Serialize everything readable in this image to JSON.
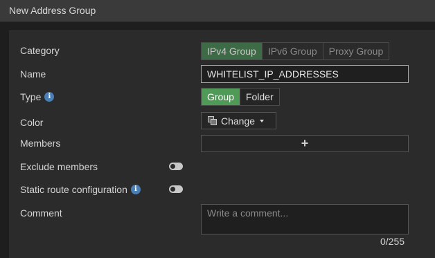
{
  "window": {
    "title": "New Address Group"
  },
  "form": {
    "category": {
      "label": "Category",
      "options": [
        "IPv4 Group",
        "IPv6 Group",
        "Proxy Group"
      ],
      "selected": "IPv4 Group"
    },
    "name": {
      "label": "Name",
      "value": "WHITELIST_IP_ADDRESSES"
    },
    "type": {
      "label": "Type",
      "options": [
        "Group",
        "Folder"
      ],
      "selected": "Group"
    },
    "color": {
      "label": "Color",
      "button_label": "Change"
    },
    "members": {
      "label": "Members",
      "add_symbol": "+"
    },
    "exclude_members": {
      "label": "Exclude members",
      "enabled": false
    },
    "static_route": {
      "label": "Static route configuration",
      "enabled": false
    },
    "comment": {
      "label": "Comment",
      "placeholder": "Write a comment...",
      "counter": "0/255"
    }
  },
  "colors": {
    "accent": "#4e9a56",
    "accent_dim": "#3d6b45",
    "info": "#4a7fb5"
  },
  "icons": {
    "info": "info-icon",
    "color": "palette-icon",
    "dropdown": "caret-down-icon"
  }
}
